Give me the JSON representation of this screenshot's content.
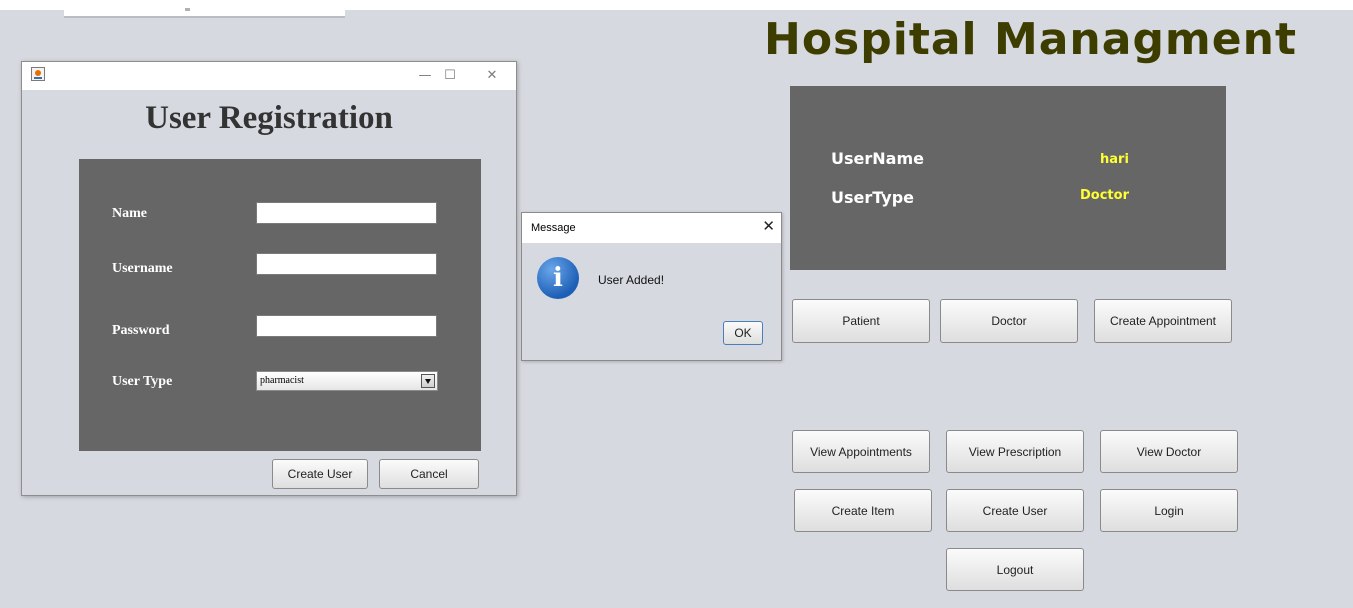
{
  "dashboard": {
    "title": "Hospital Managment",
    "info": {
      "username_label": "UserName",
      "username_value": "hari",
      "usertype_label": "UserType",
      "usertype_value": "Doctor"
    },
    "buttons": {
      "patient": "Patient",
      "doctor": "Doctor",
      "create_appointment": "Create Appointment",
      "view_appointments": "View Appointments",
      "view_prescription": "View Prescription",
      "view_doctor": "View Doctor",
      "create_item": "Create Item",
      "create_user": "Create User",
      "login": "Login",
      "logout": "Logout"
    }
  },
  "registration": {
    "heading": "User Registration",
    "window_controls": {
      "minimize": "—",
      "maximize": "☐",
      "close": "✕"
    },
    "fields": {
      "name_label": "Name",
      "name_value": "",
      "username_label": "Username",
      "username_value": "",
      "password_label": "Password",
      "password_value": "",
      "usertype_label": "User Type",
      "usertype_selected": "pharmacist"
    },
    "buttons": {
      "create": "Create User",
      "cancel": "Cancel"
    }
  },
  "message_dialog": {
    "title": "Message",
    "close_glyph": "✕",
    "icon": "information-icon",
    "icon_glyph": "i",
    "text": "User Added!",
    "ok": "OK"
  },
  "colors": {
    "desktop_background": "#d6d9df",
    "panel_background": "#666666",
    "title_color": "#3d3d00",
    "value_highlight": "#ffff33"
  }
}
